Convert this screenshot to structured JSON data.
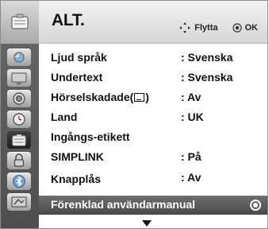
{
  "header": {
    "title": "ALT.",
    "move_hint": "Flytta",
    "ok_hint": "OK"
  },
  "sidebar": {
    "items": [
      {
        "icon": "picture-icon"
      },
      {
        "icon": "screen-icon"
      },
      {
        "icon": "audio-icon"
      },
      {
        "icon": "clock-icon"
      },
      {
        "icon": "option-icon",
        "active": true
      },
      {
        "icon": "lock-icon"
      },
      {
        "icon": "bluetooth-icon"
      },
      {
        "icon": "usb-media-icon"
      }
    ]
  },
  "menu": {
    "rows": [
      {
        "label": "Ljud språk",
        "value": ": Svenska"
      },
      {
        "label": "Undertext",
        "value": ": Svenska"
      },
      {
        "label_prefix": "Hörselskadade(",
        "label_suffix": ")",
        "value": ": Av"
      },
      {
        "label": "Land",
        "value": ": UK"
      },
      {
        "label": "Ingångs-etikett",
        "value": ""
      },
      {
        "label": "SIMPLINK",
        "value": ": På"
      },
      {
        "label": "Knapplås",
        "value": ": Av"
      },
      {
        "label": "Förenklad användarmanual",
        "value": ""
      }
    ]
  },
  "colors": {
    "highlight": "#5a5a5a",
    "sidebar": "#5b5b5b",
    "header": "#e4e4e4"
  }
}
